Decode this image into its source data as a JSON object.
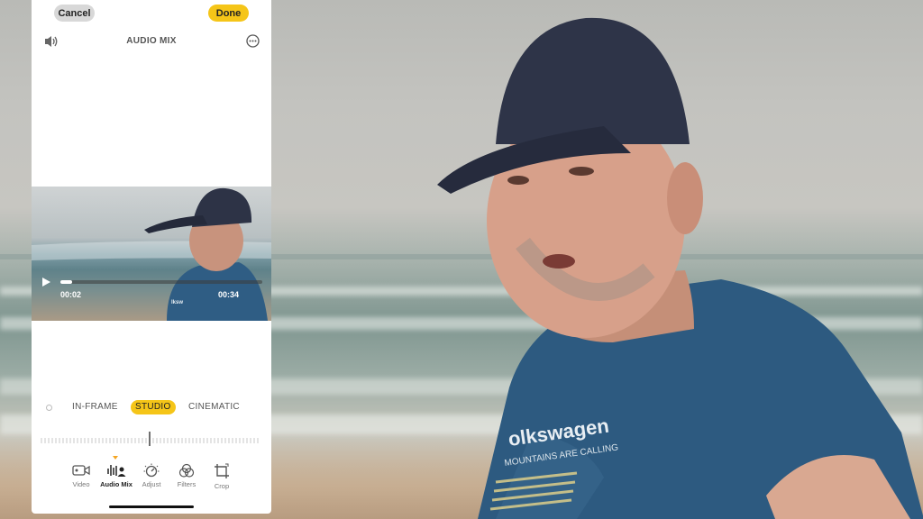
{
  "top_bar": {
    "cancel_label": "Cancel",
    "done_label": "Done",
    "title": "AUDIO MIX"
  },
  "player": {
    "current_time": "00:02",
    "total_time": "00:34",
    "progress": 0.06
  },
  "audio_modes": {
    "items": [
      "IN-FRAME",
      "STUDIO",
      "CINEMATIC"
    ],
    "selected": "STUDIO"
  },
  "tabs": [
    {
      "label": "Video",
      "icon": "video-camera-icon"
    },
    {
      "label": "Audio Mix",
      "icon": "audio-mix-icon"
    },
    {
      "label": "Adjust",
      "icon": "adjust-dial-icon"
    },
    {
      "label": "Filters",
      "icon": "filters-icon"
    },
    {
      "label": "Crop",
      "icon": "crop-icon"
    }
  ],
  "active_tab": "Audio Mix",
  "colors": {
    "accent": "#f5c518",
    "marker": "#f5a623"
  }
}
